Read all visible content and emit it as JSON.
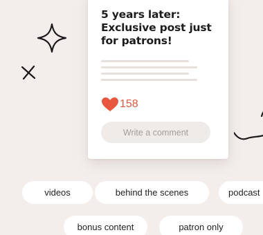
{
  "post": {
    "title": "5 years later: Exclusive post just for patrons!",
    "like_count": "158",
    "comment_placeholder": "Write a comment"
  },
  "tags": {
    "videos": "videos",
    "behind_the_scenes": "behind the scenes",
    "podcast": "podcast",
    "bonus_content": "bonus content",
    "patron_only": "patron only"
  },
  "colors": {
    "background": "#f3eeec",
    "card": "#ffffff",
    "heart": "#e8573f",
    "placeholder_lines": "#e6dfdc",
    "comment_field": "#efebe9"
  },
  "icons": {
    "star": "sparkle-star-icon",
    "x": "sparkle-x-icon",
    "squiggle": "squiggle-doodle-icon",
    "heart": "heart-icon"
  }
}
